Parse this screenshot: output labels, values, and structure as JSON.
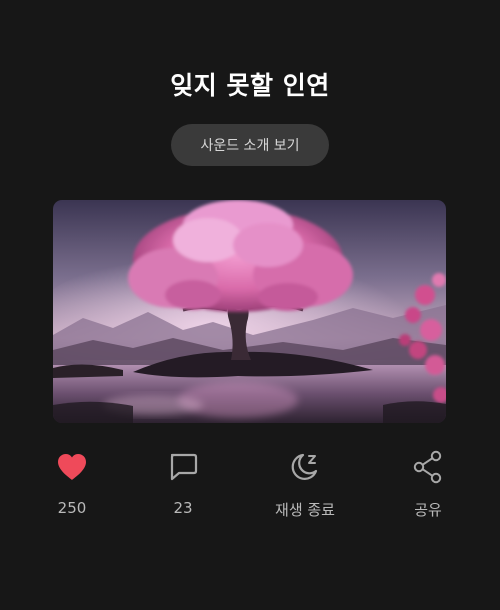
{
  "title": "잊지 못할 인연",
  "intro_button": {
    "label": "사운드 소개 보기"
  },
  "artwork": {
    "description_icon": "tree-artwork-image"
  },
  "actions": {
    "like": {
      "label": "250",
      "icon": "heart-icon",
      "color": "#ef4a5a",
      "liked": true
    },
    "comment": {
      "label": "23",
      "icon": "comment-icon"
    },
    "sleep_timer": {
      "label": "재생 종료",
      "icon": "moon-sleep-icon"
    },
    "share": {
      "label": "공유",
      "icon": "share-icon"
    }
  },
  "colors": {
    "background": "#171717",
    "button_bg": "#3a3a3a",
    "icon_stroke": "#a8a8a8",
    "label": "#b9b9b9"
  }
}
